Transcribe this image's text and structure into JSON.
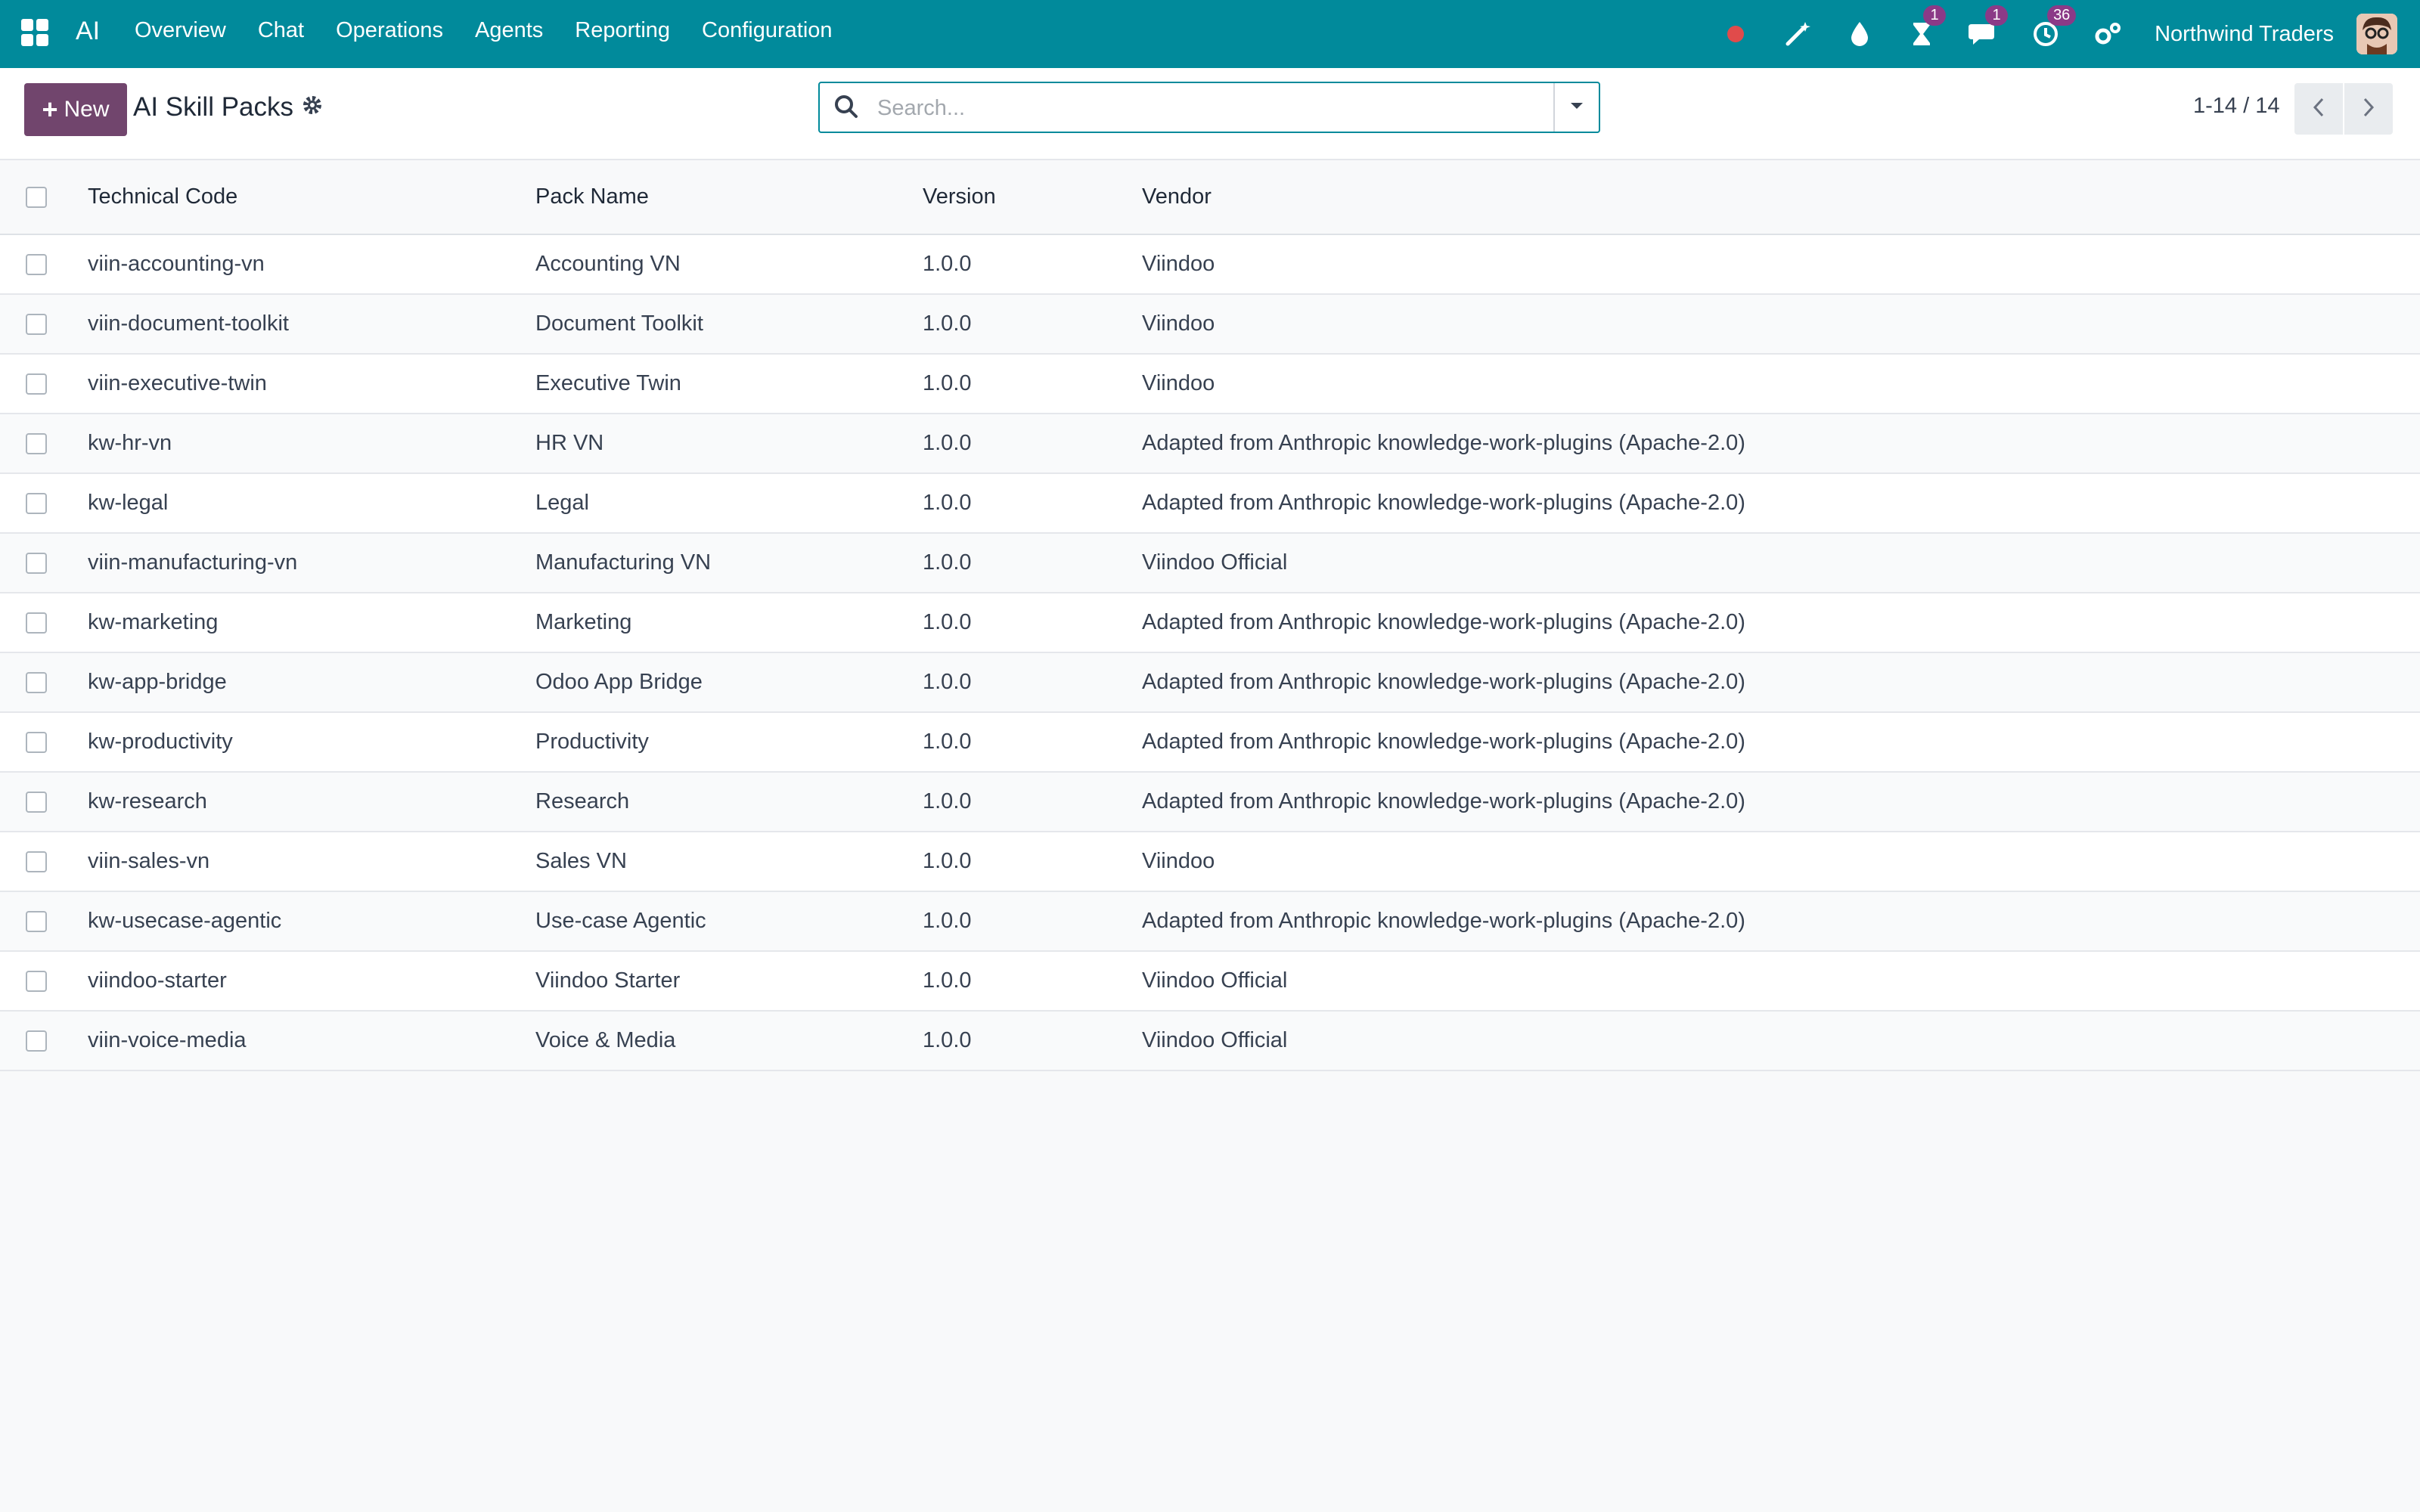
{
  "navbar": {
    "brand": "AI",
    "menu": [
      "Overview",
      "Chat",
      "Operations",
      "Agents",
      "Reporting",
      "Configuration"
    ],
    "activity_badge": "1",
    "messages_badge": "1",
    "clock_badge": "36",
    "company": "Northwind Traders",
    "colors": {
      "navbar": "#018a9b",
      "badge": "#8b3a87",
      "recording_dot": "#e04b4b"
    }
  },
  "control": {
    "new_label": "New",
    "title": "AI Skill Packs",
    "search_placeholder": "Search...",
    "pager": "1-14 / 14",
    "new_button_color": "#71456d"
  },
  "table": {
    "headers": [
      "Technical Code",
      "Pack Name",
      "Version",
      "Vendor"
    ],
    "rows": [
      [
        "viin-accounting-vn",
        "Accounting VN",
        "1.0.0",
        "Viindoo"
      ],
      [
        "viin-document-toolkit",
        "Document Toolkit",
        "1.0.0",
        "Viindoo"
      ],
      [
        "viin-executive-twin",
        "Executive Twin",
        "1.0.0",
        "Viindoo"
      ],
      [
        "kw-hr-vn",
        "HR VN",
        "1.0.0",
        "Adapted from Anthropic knowledge-work-plugins (Apache-2.0)"
      ],
      [
        "kw-legal",
        "Legal",
        "1.0.0",
        "Adapted from Anthropic knowledge-work-plugins (Apache-2.0)"
      ],
      [
        "viin-manufacturing-vn",
        "Manufacturing VN",
        "1.0.0",
        "Viindoo Official"
      ],
      [
        "kw-marketing",
        "Marketing",
        "1.0.0",
        "Adapted from Anthropic knowledge-work-plugins (Apache-2.0)"
      ],
      [
        "kw-app-bridge",
        "Odoo App Bridge",
        "1.0.0",
        "Adapted from Anthropic knowledge-work-plugins (Apache-2.0)"
      ],
      [
        "kw-productivity",
        "Productivity",
        "1.0.0",
        "Adapted from Anthropic knowledge-work-plugins (Apache-2.0)"
      ],
      [
        "kw-research",
        "Research",
        "1.0.0",
        "Adapted from Anthropic knowledge-work-plugins (Apache-2.0)"
      ],
      [
        "viin-sales-vn",
        "Sales VN",
        "1.0.0",
        "Viindoo"
      ],
      [
        "kw-usecase-agentic",
        "Use-case Agentic",
        "1.0.0",
        "Adapted from Anthropic knowledge-work-plugins (Apache-2.0)"
      ],
      [
        "viindoo-starter",
        "Viindoo Starter",
        "1.0.0",
        "Viindoo Official"
      ],
      [
        "viin-voice-media",
        "Voice & Media",
        "1.0.0",
        "Viindoo Official"
      ]
    ]
  }
}
